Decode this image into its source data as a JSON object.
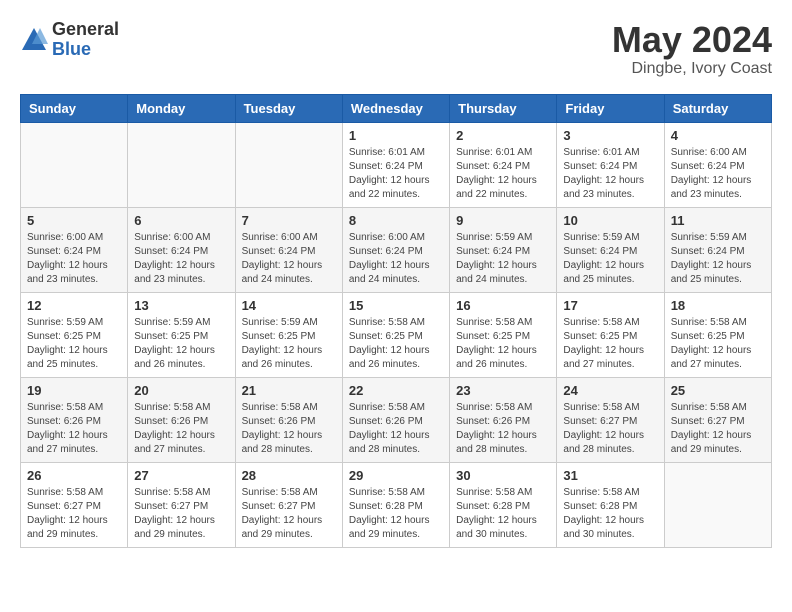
{
  "header": {
    "logo_general": "General",
    "logo_blue": "Blue",
    "month": "May 2024",
    "location": "Dingbe, Ivory Coast"
  },
  "weekdays": [
    "Sunday",
    "Monday",
    "Tuesday",
    "Wednesday",
    "Thursday",
    "Friday",
    "Saturday"
  ],
  "weeks": [
    [
      {
        "day": "",
        "info": ""
      },
      {
        "day": "",
        "info": ""
      },
      {
        "day": "",
        "info": ""
      },
      {
        "day": "1",
        "info": "Sunrise: 6:01 AM\nSunset: 6:24 PM\nDaylight: 12 hours\nand 22 minutes."
      },
      {
        "day": "2",
        "info": "Sunrise: 6:01 AM\nSunset: 6:24 PM\nDaylight: 12 hours\nand 22 minutes."
      },
      {
        "day": "3",
        "info": "Sunrise: 6:01 AM\nSunset: 6:24 PM\nDaylight: 12 hours\nand 23 minutes."
      },
      {
        "day": "4",
        "info": "Sunrise: 6:00 AM\nSunset: 6:24 PM\nDaylight: 12 hours\nand 23 minutes."
      }
    ],
    [
      {
        "day": "5",
        "info": "Sunrise: 6:00 AM\nSunset: 6:24 PM\nDaylight: 12 hours\nand 23 minutes."
      },
      {
        "day": "6",
        "info": "Sunrise: 6:00 AM\nSunset: 6:24 PM\nDaylight: 12 hours\nand 23 minutes."
      },
      {
        "day": "7",
        "info": "Sunrise: 6:00 AM\nSunset: 6:24 PM\nDaylight: 12 hours\nand 24 minutes."
      },
      {
        "day": "8",
        "info": "Sunrise: 6:00 AM\nSunset: 6:24 PM\nDaylight: 12 hours\nand 24 minutes."
      },
      {
        "day": "9",
        "info": "Sunrise: 5:59 AM\nSunset: 6:24 PM\nDaylight: 12 hours\nand 24 minutes."
      },
      {
        "day": "10",
        "info": "Sunrise: 5:59 AM\nSunset: 6:24 PM\nDaylight: 12 hours\nand 25 minutes."
      },
      {
        "day": "11",
        "info": "Sunrise: 5:59 AM\nSunset: 6:24 PM\nDaylight: 12 hours\nand 25 minutes."
      }
    ],
    [
      {
        "day": "12",
        "info": "Sunrise: 5:59 AM\nSunset: 6:25 PM\nDaylight: 12 hours\nand 25 minutes."
      },
      {
        "day": "13",
        "info": "Sunrise: 5:59 AM\nSunset: 6:25 PM\nDaylight: 12 hours\nand 26 minutes."
      },
      {
        "day": "14",
        "info": "Sunrise: 5:59 AM\nSunset: 6:25 PM\nDaylight: 12 hours\nand 26 minutes."
      },
      {
        "day": "15",
        "info": "Sunrise: 5:58 AM\nSunset: 6:25 PM\nDaylight: 12 hours\nand 26 minutes."
      },
      {
        "day": "16",
        "info": "Sunrise: 5:58 AM\nSunset: 6:25 PM\nDaylight: 12 hours\nand 26 minutes."
      },
      {
        "day": "17",
        "info": "Sunrise: 5:58 AM\nSunset: 6:25 PM\nDaylight: 12 hours\nand 27 minutes."
      },
      {
        "day": "18",
        "info": "Sunrise: 5:58 AM\nSunset: 6:25 PM\nDaylight: 12 hours\nand 27 minutes."
      }
    ],
    [
      {
        "day": "19",
        "info": "Sunrise: 5:58 AM\nSunset: 6:26 PM\nDaylight: 12 hours\nand 27 minutes."
      },
      {
        "day": "20",
        "info": "Sunrise: 5:58 AM\nSunset: 6:26 PM\nDaylight: 12 hours\nand 27 minutes."
      },
      {
        "day": "21",
        "info": "Sunrise: 5:58 AM\nSunset: 6:26 PM\nDaylight: 12 hours\nand 28 minutes."
      },
      {
        "day": "22",
        "info": "Sunrise: 5:58 AM\nSunset: 6:26 PM\nDaylight: 12 hours\nand 28 minutes."
      },
      {
        "day": "23",
        "info": "Sunrise: 5:58 AM\nSunset: 6:26 PM\nDaylight: 12 hours\nand 28 minutes."
      },
      {
        "day": "24",
        "info": "Sunrise: 5:58 AM\nSunset: 6:27 PM\nDaylight: 12 hours\nand 28 minutes."
      },
      {
        "day": "25",
        "info": "Sunrise: 5:58 AM\nSunset: 6:27 PM\nDaylight: 12 hours\nand 29 minutes."
      }
    ],
    [
      {
        "day": "26",
        "info": "Sunrise: 5:58 AM\nSunset: 6:27 PM\nDaylight: 12 hours\nand 29 minutes."
      },
      {
        "day": "27",
        "info": "Sunrise: 5:58 AM\nSunset: 6:27 PM\nDaylight: 12 hours\nand 29 minutes."
      },
      {
        "day": "28",
        "info": "Sunrise: 5:58 AM\nSunset: 6:27 PM\nDaylight: 12 hours\nand 29 minutes."
      },
      {
        "day": "29",
        "info": "Sunrise: 5:58 AM\nSunset: 6:28 PM\nDaylight: 12 hours\nand 29 minutes."
      },
      {
        "day": "30",
        "info": "Sunrise: 5:58 AM\nSunset: 6:28 PM\nDaylight: 12 hours\nand 30 minutes."
      },
      {
        "day": "31",
        "info": "Sunrise: 5:58 AM\nSunset: 6:28 PM\nDaylight: 12 hours\nand 30 minutes."
      },
      {
        "day": "",
        "info": ""
      }
    ]
  ]
}
